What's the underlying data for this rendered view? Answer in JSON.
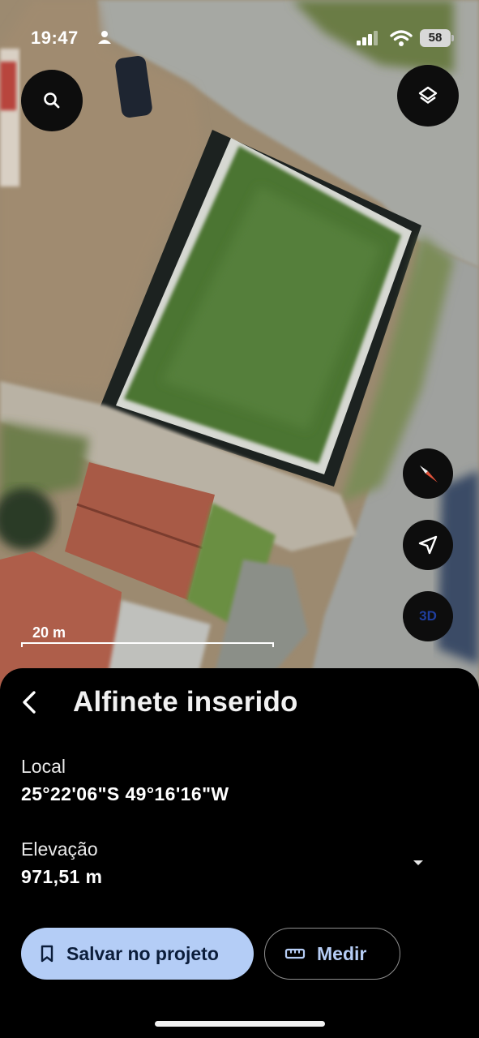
{
  "status_bar": {
    "time": "19:47",
    "battery": "58"
  },
  "map": {
    "scale_label": "20 m",
    "threed_label": "3D"
  },
  "icons": {
    "search": "search-icon",
    "layers": "layers-icon",
    "compass": "compass-icon",
    "locate": "navigation-arrow-icon",
    "back": "chevron-left-icon",
    "bookmark": "bookmark-icon",
    "ruler": "ruler-icon",
    "dropdown": "caret-down-icon"
  },
  "sheet": {
    "title": "Alfinete inserido",
    "location_label": "Local",
    "location_value": "25°22'06\"S 49°16'16\"W",
    "elevation_label": "Elevação",
    "elevation_value": "971,51 m",
    "save_button": "Salvar no projeto",
    "measure_button": "Medir"
  },
  "colors": {
    "accent": "#b4cdf6",
    "sheet_background": "#000000",
    "compass_red": "#e2533b"
  }
}
